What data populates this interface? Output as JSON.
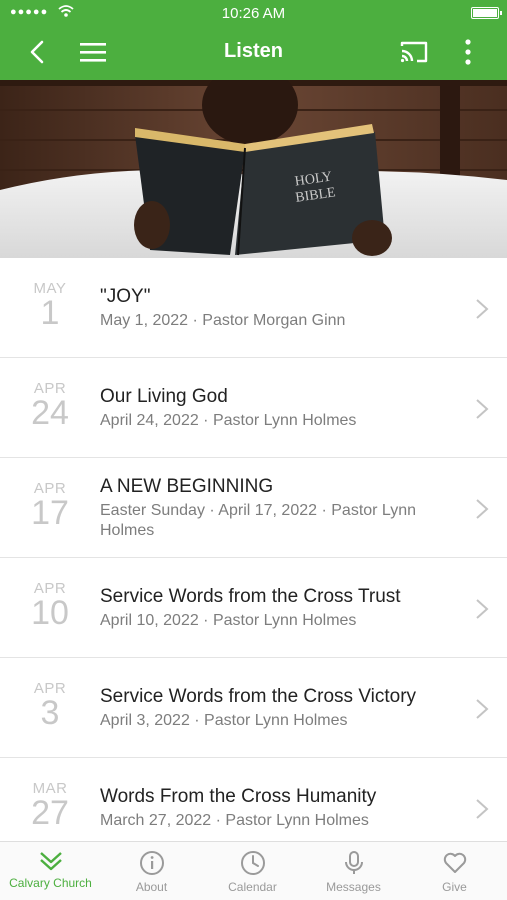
{
  "status": {
    "time": "10:26 AM"
  },
  "nav": {
    "title": "Listen"
  },
  "sermons": [
    {
      "month": "MAY",
      "day": "1",
      "title": "\"JOY\"",
      "meta": "May 1, 2022 · Pastor Morgan Ginn"
    },
    {
      "month": "APR",
      "day": "24",
      "title": "Our Living God",
      "meta": "April 24, 2022 · Pastor Lynn Holmes"
    },
    {
      "month": "APR",
      "day": "17",
      "title": "A NEW BEGINNING",
      "meta": "Easter Sunday · April 17, 2022 · Pastor Lynn Holmes"
    },
    {
      "month": "APR",
      "day": "10",
      "title": "Service Words from the Cross Trust",
      "meta": "April 10, 2022 · Pastor Lynn Holmes"
    },
    {
      "month": "APR",
      "day": "3",
      "title": "Service Words from the Cross Victory",
      "meta": "April 3, 2022 · Pastor Lynn Holmes"
    },
    {
      "month": "MAR",
      "day": "27",
      "title": "Words From the Cross Humanity",
      "meta": "March 27, 2022 · Pastor Lynn Holmes"
    }
  ],
  "hero": {
    "book_line1": "HOLY",
    "book_line2": "BIBLE"
  },
  "tabs": [
    {
      "label": "Calvary Church",
      "icon": "chevrons-down-icon"
    },
    {
      "label": "About",
      "icon": "info-icon"
    },
    {
      "label": "Calendar",
      "icon": "clock-icon"
    },
    {
      "label": "Messages",
      "icon": "microphone-icon"
    },
    {
      "label": "Give",
      "icon": "heart-icon"
    }
  ],
  "colors": {
    "brand": "#4caf3f",
    "text": "#222222",
    "meta": "#7d7d7d",
    "date": "#c8c8c8"
  }
}
